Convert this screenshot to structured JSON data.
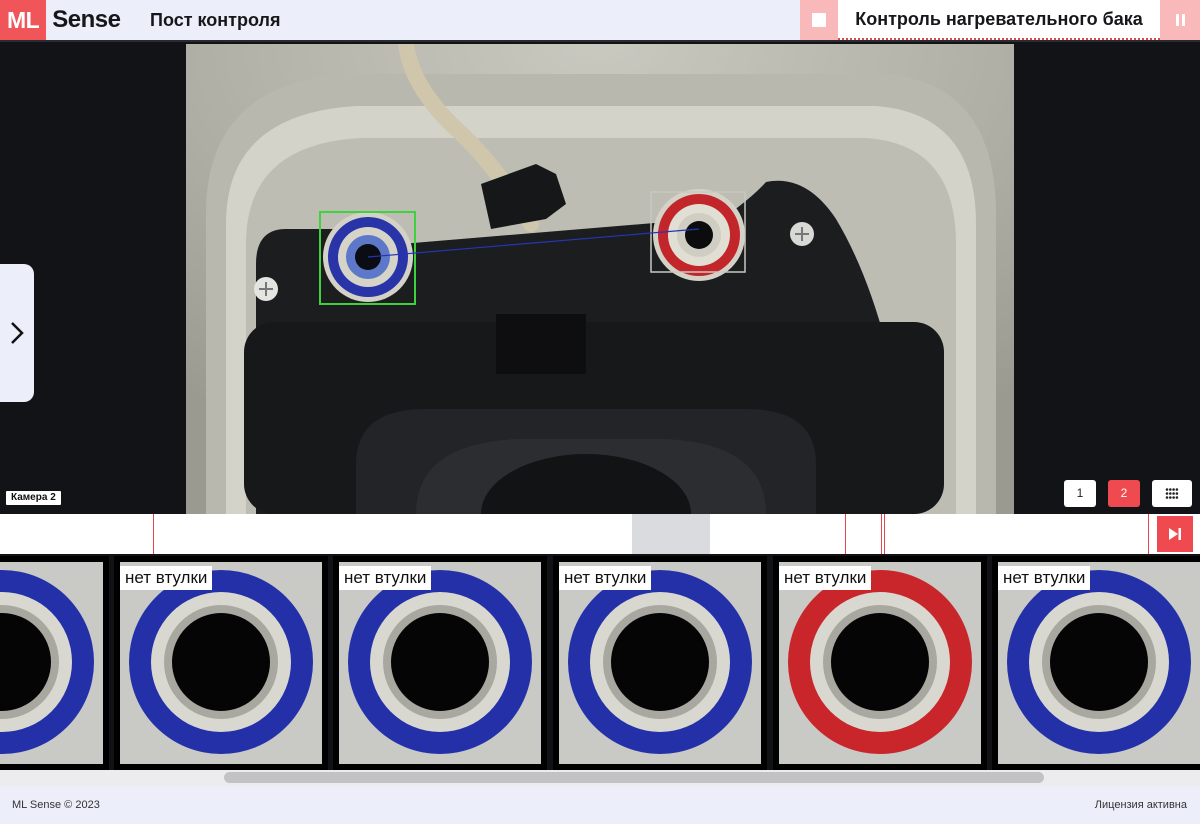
{
  "header": {
    "logo_ml": "ML",
    "logo_sense": "Sense",
    "post_title": "Пост контроля",
    "mode_title": "Контроль нагревательного бака"
  },
  "viewer": {
    "camera_label": "Камера 2",
    "pages": [
      "1",
      "2"
    ],
    "active_page": "2"
  },
  "thumbnails": [
    {
      "label": "",
      "ring_color": "#2330a8"
    },
    {
      "label": "нет втулки",
      "ring_color": "#2330a8"
    },
    {
      "label": "нет втулки",
      "ring_color": "#2330a8"
    },
    {
      "label": "нет втулки",
      "ring_color": "#2330a8"
    },
    {
      "label": "нет втулки",
      "ring_color": "#c8262b"
    },
    {
      "label": "нет втулки",
      "ring_color": "#2330a8"
    }
  ],
  "footer": {
    "copyright": "ML Sense © 2023",
    "license": "Лицензия активна"
  },
  "colors": {
    "accent": "#ef4a4f",
    "accent_light": "#f9b9bb",
    "header_bg": "#eceef9",
    "detect_box": "#3fd23f"
  }
}
